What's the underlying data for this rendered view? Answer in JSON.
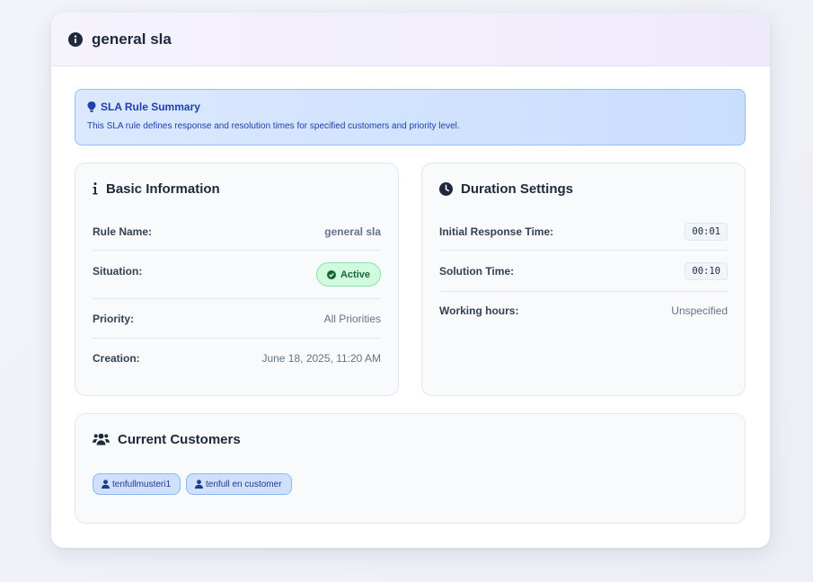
{
  "header": {
    "title": "general sla",
    "icon": "info-circle-icon"
  },
  "summary": {
    "title": "SLA Rule Summary",
    "description": "This SLA rule defines response and resolution times for specified customers and priority level.",
    "icon": "lightbulb-icon"
  },
  "basic": {
    "title": "Basic Information",
    "icon": "info-icon",
    "rows": [
      {
        "label": "Rule Name:",
        "value": "general sla"
      },
      {
        "label": "Situation:",
        "value": "Active"
      },
      {
        "label": "Priority:",
        "value": "All Priorities"
      },
      {
        "label": "Creation:",
        "value": "June 18, 2025, 11:20 AM"
      }
    ]
  },
  "duration": {
    "title": "Duration Settings",
    "icon": "clock-icon",
    "rows": [
      {
        "label": "Initial Response Time:",
        "value": "00:01"
      },
      {
        "label": "Solution Time:",
        "value": "00:10"
      },
      {
        "label": "Working hours:",
        "value": "Unspecified"
      }
    ]
  },
  "customers": {
    "title": "Current Customers",
    "icon": "users-icon",
    "items": [
      "tenfullmusteri1",
      "tenfull en customer"
    ]
  },
  "colors": {
    "accent": "#1e40af",
    "active_bg": "#d1fadf",
    "active_text": "#166534"
  }
}
